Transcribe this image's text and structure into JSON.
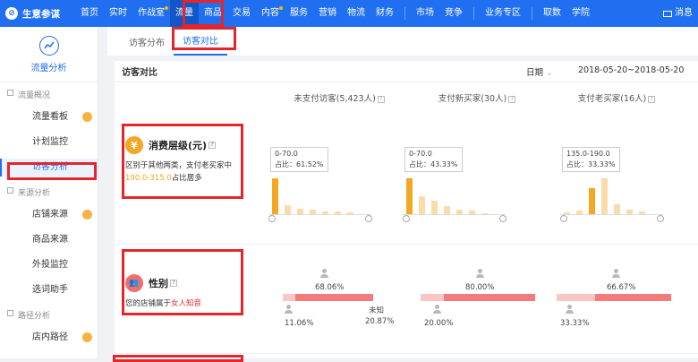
{
  "app": {
    "name": "生意参谋",
    "logo_glyph": "⊘"
  },
  "nav": {
    "items": [
      "首页",
      "实时",
      "作战室",
      "流量",
      "商品",
      "交易",
      "内容",
      "服务",
      "营销",
      "物流",
      "财务",
      "市场",
      "竞争",
      "业务专区",
      "取数",
      "学院"
    ],
    "active": "流量",
    "message_label": "消息"
  },
  "sidebar": {
    "title": "流量分析",
    "groups": [
      {
        "label": "流量概况",
        "items": [
          "流量看板",
          "计划监控",
          "访客分析"
        ]
      },
      {
        "label": "来源分析",
        "items": [
          "店铺来源",
          "商品来源",
          "外投监控",
          "选词助手"
        ]
      },
      {
        "label": "路径分析",
        "items": [
          "店内路径"
        ]
      }
    ],
    "active_item": "访客分析"
  },
  "tabs": {
    "items": [
      "访客分布",
      "访客对比"
    ],
    "active": "访客对比"
  },
  "panel": {
    "title": "访客对比",
    "date_label": "日期",
    "date_range": "2018-05-20~2018-05-20",
    "columns": [
      {
        "label": "未支付访客(5,423人)"
      },
      {
        "label": "支付新买家(30人)"
      },
      {
        "label": "支付老买家(16人)"
      }
    ],
    "help_glyph": "?"
  },
  "consumption": {
    "title": "消费层级(元)",
    "icon_glyph": "¥",
    "desc_pre": "区别于其他两类，支付老买家中",
    "desc_highlight": "190.0-315.0",
    "desc_post": "占比居多",
    "charts": [
      {
        "range": "0-70.0",
        "share": "占比：61.52%",
        "values": [
          0.62,
          0.16,
          0.1,
          0.08,
          0.05,
          0.04,
          0.03
        ],
        "highlight": 0
      },
      {
        "range": "0-70.0",
        "share": "占比：43.33%",
        "values": [
          0.43,
          0.22,
          0.16,
          0.1,
          0.05,
          0.04,
          0.0
        ],
        "highlight": 0
      },
      {
        "range": "135.0-190.0",
        "share": "占比：33.33%",
        "values": [
          0.02,
          0.04,
          0.33,
          0.45,
          0.12,
          0.06,
          0.03
        ],
        "highlight": 2
      }
    ]
  },
  "gender": {
    "title": "性别",
    "icon_glyph": "👥",
    "desc_pre": "您的店铺属于",
    "desc_highlight": "女人知音",
    "unknown_label": "未知",
    "blocks": [
      {
        "female": "68.06%",
        "male": "11.06%",
        "unknown": "20.87%",
        "female_v": 68.06,
        "male_v": 11.06
      },
      {
        "female": "80.00%",
        "male": "20.00%",
        "female_v": 80.0,
        "male_v": 20.0
      },
      {
        "female": "66.67%",
        "male": "33.33%",
        "female_v": 66.67,
        "male_v": 33.33
      }
    ]
  },
  "colors": {
    "brand": "#1f6ff0",
    "accent": "#f5a623",
    "highlight_red": "#e3262c"
  }
}
